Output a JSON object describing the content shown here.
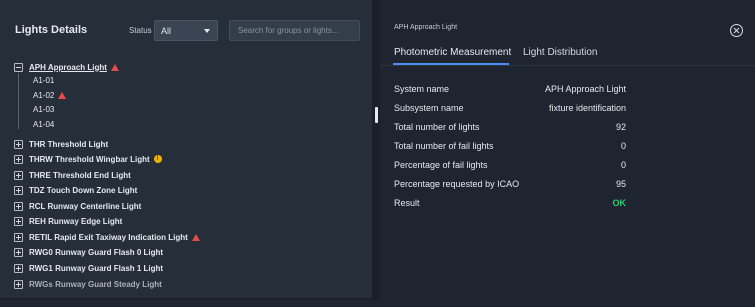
{
  "left": {
    "title": "Lights Details",
    "status_label": "Status",
    "status_value": "All",
    "search_placeholder": "Search for groups or lights...",
    "groups": [
      {
        "label": "APH Approach Light",
        "expanded": true,
        "alert": "error",
        "children": [
          {
            "label": "A1-01",
            "alert": null
          },
          {
            "label": "A1-02",
            "alert": "error"
          },
          {
            "label": "A1-03",
            "alert": null
          },
          {
            "label": "A1-04",
            "alert": null
          }
        ]
      },
      {
        "label": "THR Threshold Light",
        "alert": null
      },
      {
        "label": "THRW Threshold Wingbar Light",
        "alert": "warning"
      },
      {
        "label": "THRE Threshold End Light",
        "alert": null
      },
      {
        "label": "TDZ Touch Down Zone Light",
        "alert": null
      },
      {
        "label": "RCL Runway Centerline Light",
        "alert": null
      },
      {
        "label": "REH Runway Edge Light",
        "alert": null
      },
      {
        "label": "RETIL Rapid Exit Taxiway Indication Light",
        "alert": "error"
      },
      {
        "label": "RWG0 Runway Guard Flash 0 Light",
        "alert": null
      },
      {
        "label": "RWG1 Runway Guard Flash 1 Light",
        "alert": null
      },
      {
        "label": "RWGs Runway Guard Steady Light",
        "alert": null
      }
    ],
    "warning_glyph": "!"
  },
  "right": {
    "title": "APH Approach Light",
    "tabs": [
      "Photometric Measurement",
      "Light Distribution"
    ],
    "active_tab": "Photometric Measurement",
    "details": [
      {
        "key": "System name",
        "value": "APH Approach Light"
      },
      {
        "key": "Subsystem name",
        "value": "fixture identification"
      },
      {
        "key": "Total number of lights",
        "value": "92"
      },
      {
        "key": "Total number of fail lights",
        "value": "0"
      },
      {
        "key": "Percentage of fail lights",
        "value": "0"
      },
      {
        "key": "Percentage requested by ICAO",
        "value": "95"
      },
      {
        "key": "Result",
        "value": "OK"
      }
    ]
  },
  "colors": {
    "accent": "#4d8ff0",
    "error": "#e64b4b",
    "warning": "#f0b400",
    "ok": "#2fd07a"
  }
}
